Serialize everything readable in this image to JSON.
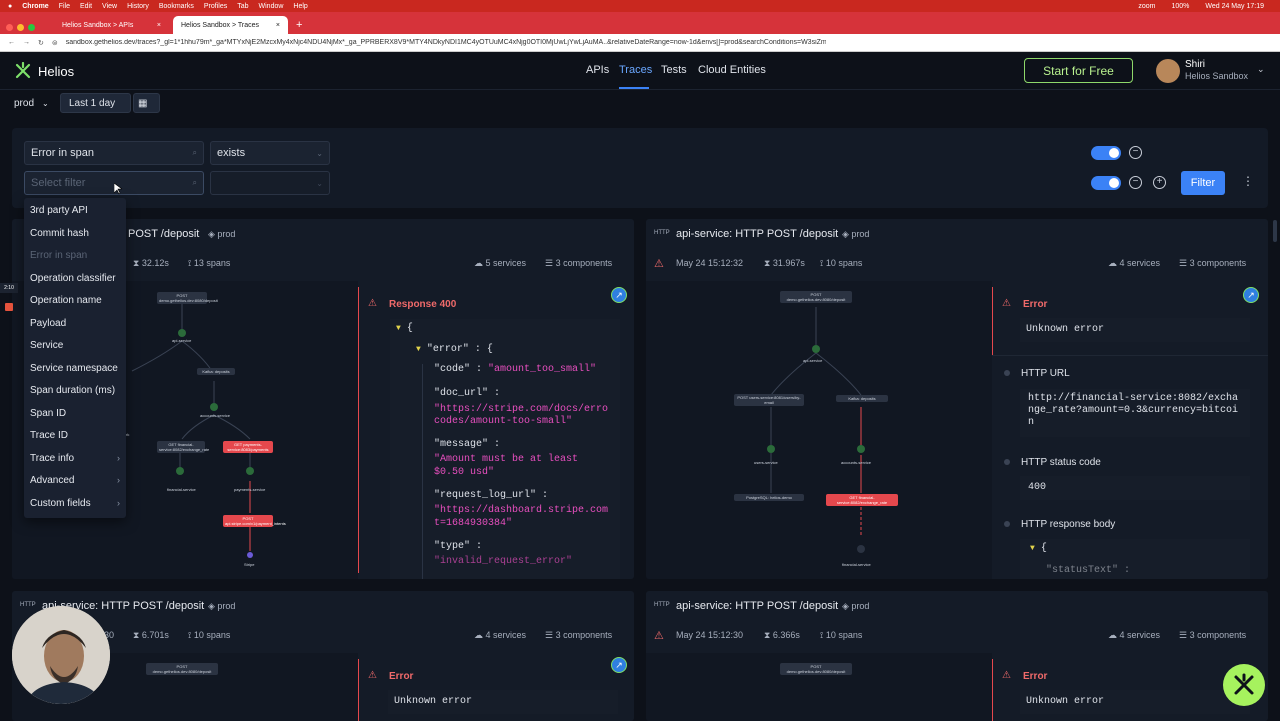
{
  "mac": {
    "app": "Chrome",
    "menus": [
      "File",
      "Edit",
      "View",
      "History",
      "Bookmarks",
      "Profiles",
      "Tab",
      "Window",
      "Help"
    ],
    "battery": "100%",
    "clock": "Wed 24 May 17:19",
    "zoom": "zoom"
  },
  "browser": {
    "tabs": [
      "Helios Sandbox > APIs",
      "Helios Sandbox > Traces"
    ],
    "url": "sandbox.gethelios.dev/traces?_gl=1*1hhu79m*_ga*MTYxNjE2MzcxMy4xNjc4NDU4NjMx*_ga_PPRBERX8V9*MTY4NDkyNDI1MC4yOTUuMC4xNjg0OTI0MjUwLjYwLjAuMA..&relativeDateRange=now-1d&envs[]=prod&searchConditions=W3siZmllbGQiOiJzcGFuRXJyb3IiLCJvcCI6ImV4aXN0cyIsImN1c3RvbSI6Zm..."
  },
  "header": {
    "logo": "Helios",
    "nav": [
      "APIs",
      "Traces",
      "Tests",
      "Cloud Entities"
    ],
    "active_nav": "Traces",
    "start": "Start for Free",
    "user_name": "Shiri",
    "user_org": "Helios Sandbox"
  },
  "env": {
    "env": "prod",
    "range": "Last 1 day"
  },
  "filters": {
    "field1": "Error in span",
    "op1": "exists",
    "field2_placeholder": "Select filter",
    "filter_btn": "Filter"
  },
  "dropdown": {
    "items": [
      "3rd party API",
      "Commit hash",
      "Error in span",
      "Operation classifier",
      "Operation name",
      "Payload",
      "Service",
      "Service namespace",
      "Span duration (ms)",
      "Span ID",
      "Trace ID",
      "Trace info",
      "Advanced",
      "Custom fields"
    ]
  },
  "cards": [
    {
      "title": "api-service: HTTP POST /deposit",
      "title_visible": "POST /deposit",
      "env": "prod",
      "time": "",
      "duration": "32.12s",
      "spans": "13 spans",
      "services": "5 services",
      "components": "3 components",
      "err": "Response 400"
    },
    {
      "title": "api-service: HTTP POST /deposit",
      "env": "prod",
      "time": "May 24 15:12:32",
      "duration": "31.967s",
      "spans": "10 spans",
      "services": "4 services",
      "components": "3 components",
      "err": "Error",
      "errmsg": "Unknown error"
    },
    {
      "title": "api-service: HTTP POST /deposit",
      "env": "prod",
      "time": "30",
      "duration": "6.701s",
      "spans": "10 spans",
      "services": "4 services",
      "components": "3 components",
      "err": "Error",
      "errmsg": "Unknown error"
    },
    {
      "title": "api-service: HTTP POST /deposit",
      "env": "prod",
      "time": "May 24 15:12:30",
      "duration": "6.366s",
      "spans": "10 spans",
      "services": "4 services",
      "components": "3 components",
      "err": "Error",
      "errmsg": "Unknown error"
    }
  ],
  "json1": {
    "error_key": "\"error\"",
    "code_key": "\"code\"",
    "code_val": "\"amount_too_small\"",
    "doc_key": "\"doc_url\"",
    "doc_val1": "\"https://stripe.com/docs/erro",
    "doc_val2": "codes/amount-too-small\"",
    "msg_key": "\"message\"",
    "msg_val1": "\"Amount must be at least",
    "msg_val2": "$0.50 usd\"",
    "req_key": "\"request_log_url\"",
    "req_val1": "\"https://dashboard.stripe.com",
    "req_val2": "t=1684930384\"",
    "type_key": "\"type\"",
    "type_val": "\"invalid_request_error\""
  },
  "detail2": {
    "http_url_label": "HTTP URL",
    "http_url": "http://financial-service:8082/exchange_rate?amount=0.3&currency=bitcoin",
    "status_label": "HTTP status code",
    "status": "400",
    "body_label": "HTTP response body",
    "body_snippet": "\"statusText\" :"
  },
  "graph1": {
    "nodes": [
      "POST demo.gethelios.dev:8080/deposit",
      "api-service",
      "Kafka: deposits",
      "accounts-service",
      "GET financial-service:8082/exchange_rate",
      "GET payments-service:8083/payments",
      "financial-service",
      "payments-service",
      "POST api.stripe.com/v1/payment_intents",
      "Stripe",
      "rk"
    ]
  },
  "graph2": {
    "nodes": [
      "POST demo.gethelios.dev:8080/deposit",
      "api-service",
      "POST users-service:8081/users/by-email",
      "Kafka: deposits",
      "users-service",
      "accounts-service",
      "PostgreSQL: helios-demo",
      "GET financial-service:8082/exchange_rate",
      "financial-service"
    ]
  },
  "misc": {
    "timer": "2:10"
  }
}
